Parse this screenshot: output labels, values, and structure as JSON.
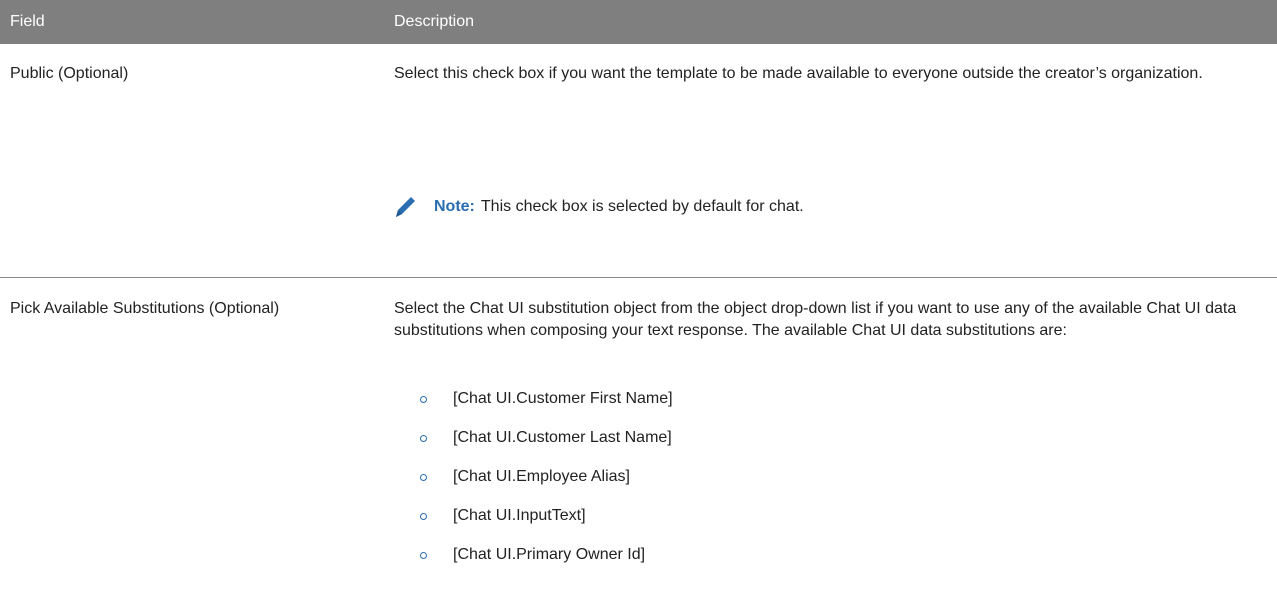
{
  "table": {
    "headers": [
      "Field",
      "Description"
    ],
    "rows": [
      {
        "field": "Public (Optional)",
        "description": "Select this check box if you want the template to be made available to everyone outside the creator’s organization.",
        "note": {
          "label": "Note:",
          "text": "This check box is selected by default for chat."
        }
      },
      {
        "field": "Pick Available Substitutions (Optional)",
        "description": "Select the Chat UI substitution object from the object drop-down list if you want to use any of the available Chat UI data substitutions when composing your text response. The available Chat UI data substitutions are:",
        "substitutions": [
          "[Chat UI.Customer First Name]",
          "[Chat UI.Customer Last Name]",
          "[Chat UI.Employee Alias]",
          "[Chat UI.InputText]",
          "[Chat UI.Primary Owner Id]"
        ]
      }
    ]
  },
  "colors": {
    "header_bg": "#7f7f7f",
    "accent": "#2a6db0",
    "text": "#222222"
  },
  "icons": {
    "note_icon": "pencil-icon",
    "list_bullet": "circle-bullet-icon"
  }
}
